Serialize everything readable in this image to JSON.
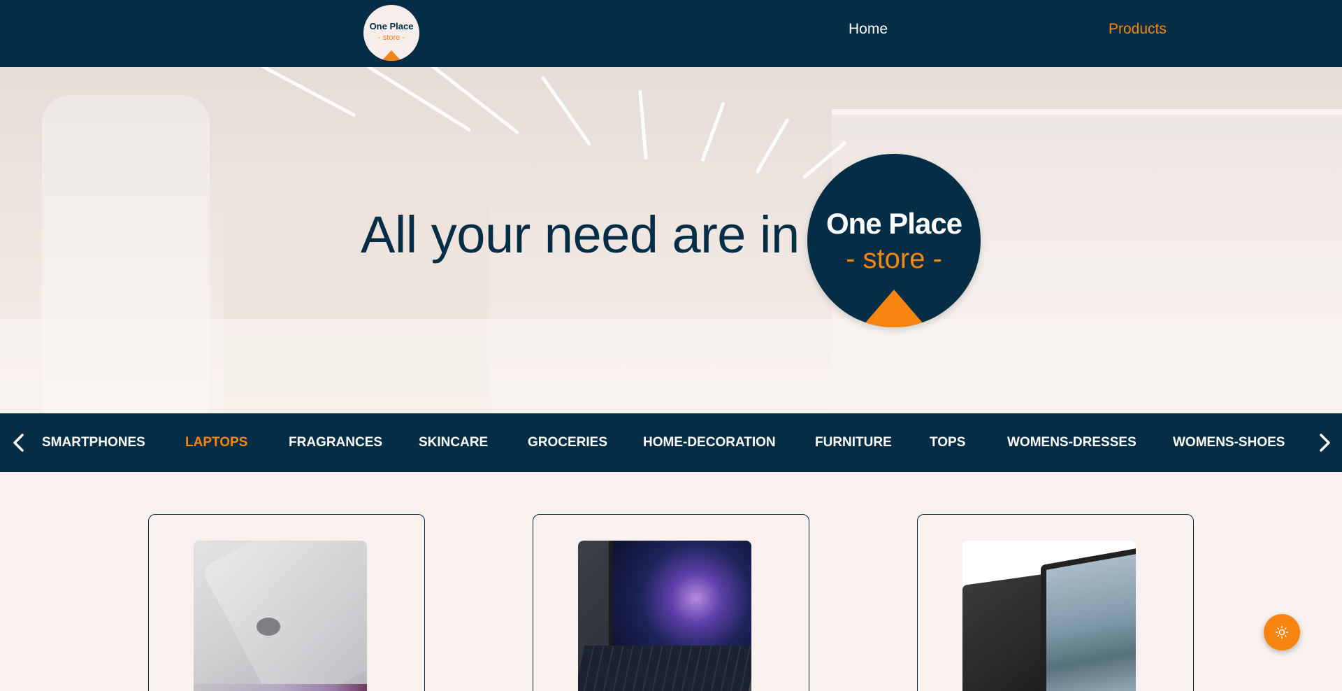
{
  "header": {
    "logo": {
      "line1": "One Place",
      "line2": "- store -"
    },
    "nav": [
      {
        "label": "Home"
      },
      {
        "label": "Products"
      }
    ]
  },
  "hero": {
    "tagline": "All your need are in",
    "logo": {
      "line1": "One Place",
      "line2": "- store -"
    }
  },
  "categories": {
    "items": [
      "SMARTPHONES",
      "LAPTOPS",
      "FRAGRANCES",
      "SKINCARE",
      "GROCERIES",
      "HOME-DECORATION",
      "FURNITURE",
      "TOPS",
      "WOMENS-DRESSES",
      "WOMENS-SHOES"
    ],
    "active": "LAPTOPS",
    "prev_icon": "chevron-left-icon",
    "next_icon": "chevron-right-icon"
  },
  "products": [
    {
      "image": "silver-laptop-lid"
    },
    {
      "image": "dark-laptop-open"
    },
    {
      "image": "black-laptop-tablet"
    }
  ],
  "theme_toggle": {
    "icon": "sun-icon"
  },
  "colors": {
    "navy": "#052d46",
    "orange": "#f6870f",
    "background": "#f9f1ee",
    "white": "#ffffff"
  }
}
